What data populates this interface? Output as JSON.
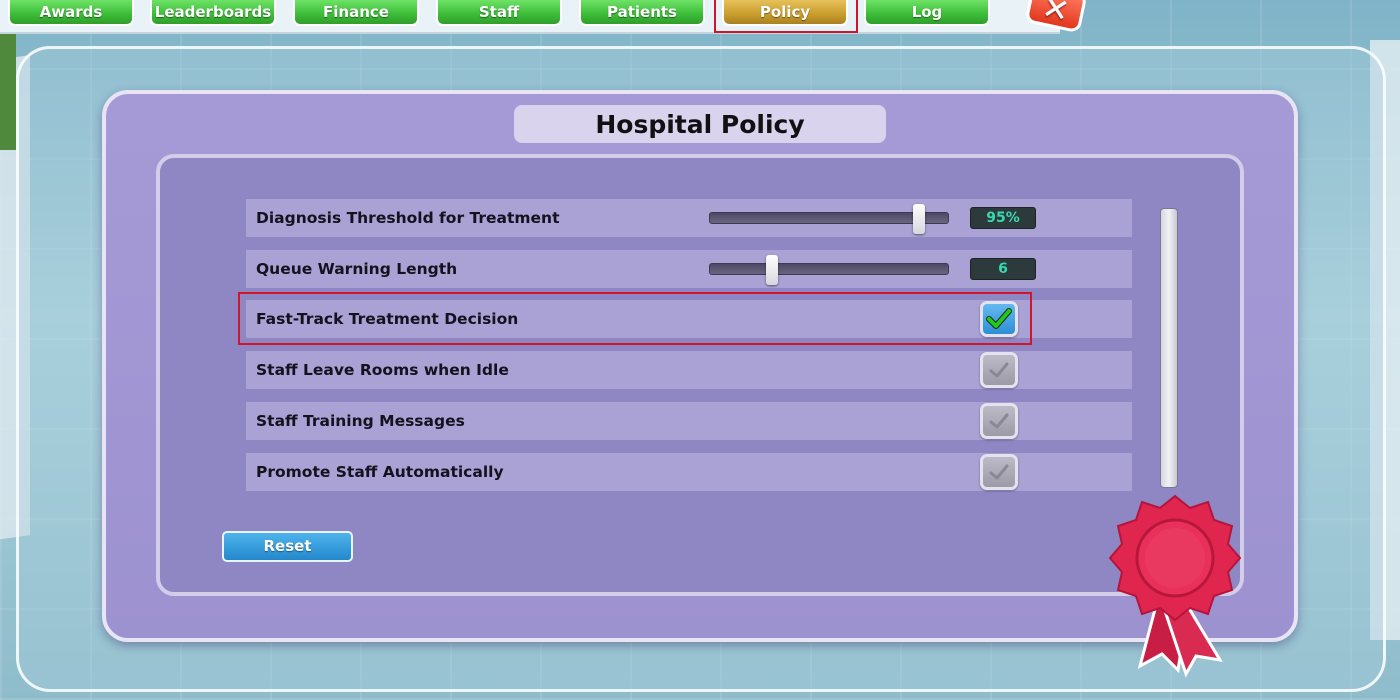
{
  "top_tabs": [
    {
      "label": "Awards"
    },
    {
      "label": "Leaderboards"
    },
    {
      "label": "Finance"
    },
    {
      "label": "Staff"
    },
    {
      "label": "Patients"
    },
    {
      "label": "Policy",
      "active": true
    },
    {
      "label": "Log"
    }
  ],
  "close_button": {
    "icon": "close-x-icon",
    "glyph": "✕"
  },
  "panel": {
    "title": "Hospital Policy"
  },
  "policies": [
    {
      "label": "Diagnosis Threshold for Treatment",
      "control": "slider",
      "slider_fraction": 0.88,
      "value": "95%"
    },
    {
      "label": "Queue Warning Length",
      "control": "slider",
      "slider_fraction": 0.26,
      "value": "6"
    },
    {
      "label": "Fast-Track Treatment Decision",
      "control": "checkbox",
      "checked": true
    },
    {
      "label": "Staff Leave Rooms when Idle",
      "control": "checkbox",
      "checked": false
    },
    {
      "label": "Staff Training Messages",
      "control": "checkbox",
      "checked": false
    },
    {
      "label": "Promote Staff Automatically",
      "control": "checkbox",
      "checked": false
    }
  ],
  "reset_button": {
    "label": "Reset"
  },
  "colors": {
    "tab_green": "#3fbf3a",
    "tab_active_gold": "#c99d2c",
    "panel_purple": "#a69ad6",
    "highlight_red": "#d0162c",
    "checkbox_on_blue": "#2d8fd6",
    "check_green": "#22c71f",
    "value_text_teal": "#39d8b0",
    "rosette_red": "#e0264e"
  }
}
